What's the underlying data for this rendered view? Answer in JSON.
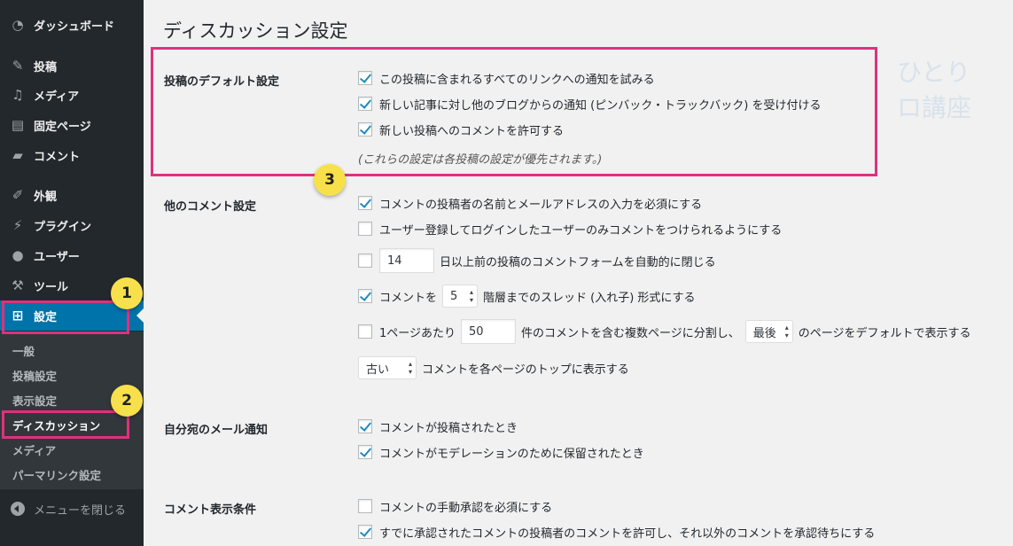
{
  "sidebar": {
    "items": [
      {
        "label": "ダッシュボード",
        "icon": "dashboard-icon"
      },
      {
        "label": "投稿",
        "icon": "pin-icon"
      },
      {
        "label": "メディア",
        "icon": "media-icon"
      },
      {
        "label": "固定ページ",
        "icon": "page-icon"
      },
      {
        "label": "コメント",
        "icon": "comment-icon"
      },
      {
        "label": "外観",
        "icon": "brush-icon"
      },
      {
        "label": "プラグイン",
        "icon": "plugin-icon"
      },
      {
        "label": "ユーザー",
        "icon": "user-icon"
      },
      {
        "label": "ツール",
        "icon": "wrench-icon"
      },
      {
        "label": "設定",
        "icon": "settings-icon"
      }
    ],
    "submenu": [
      "一般",
      "投稿設定",
      "表示設定",
      "ディスカッション",
      "メディア",
      "パーマリンク設定"
    ],
    "collapse_label": "メニューを閉じる"
  },
  "page": {
    "title": "ディスカッション設定",
    "watermark": "ひとり　　ロ講座"
  },
  "sections": {
    "default_label": "投稿のデフォルト設定",
    "default_rows": [
      {
        "label": "この投稿に含まれるすべてのリンクへの通知を試みる",
        "checked": true
      },
      {
        "label": "新しい記事に対し他のブログからの通知 (ピンバック・トラックバック) を受け付ける",
        "checked": true
      },
      {
        "label": "新しい投稿へのコメントを許可する",
        "checked": true
      }
    ],
    "default_note": "(これらの設定は各投稿の設定が優先されます。)",
    "other_label": "他のコメント設定",
    "other_rows": {
      "r1": "コメントの投稿者の名前とメールアドレスの入力を必須にする",
      "r2": "ユーザー登録してログインしたユーザーのみコメントをつけられるようにする",
      "r3_value": "14",
      "r3_text": "日以上前の投稿のコメントフォームを自動的に閉じる",
      "r4_pre": "コメントを",
      "r4_select": "5",
      "r4_post": "階層までのスレッド (入れ子) 形式にする",
      "r5_pre": "1ページあたり",
      "r5_value": "50",
      "r5_mid": "件のコメントを含む複数ページに分割し、",
      "r5_select": "最後",
      "r5_post": "のページをデフォルトで表示する",
      "r6_select": "古い",
      "r6_post": "コメントを各ページのトップに表示する"
    },
    "mail_label": "自分宛のメール通知",
    "mail_rows": [
      {
        "label": "コメントが投稿されたとき",
        "checked": true
      },
      {
        "label": "コメントがモデレーションのために保留されたとき",
        "checked": true
      }
    ],
    "display_label": "コメント表示条件",
    "display_rows": [
      {
        "label": "コメントの手動承認を必須にする",
        "checked": false
      },
      {
        "label": "すでに承認されたコメントの投稿者のコメントを許可し、それ以外のコメントを承認待ちにする",
        "checked": true
      }
    ]
  },
  "badges": [
    "1",
    "2",
    "3"
  ],
  "colors": {
    "highlight": "#e0307e",
    "badge": "#f8e04a",
    "accent": "#0073aa"
  }
}
